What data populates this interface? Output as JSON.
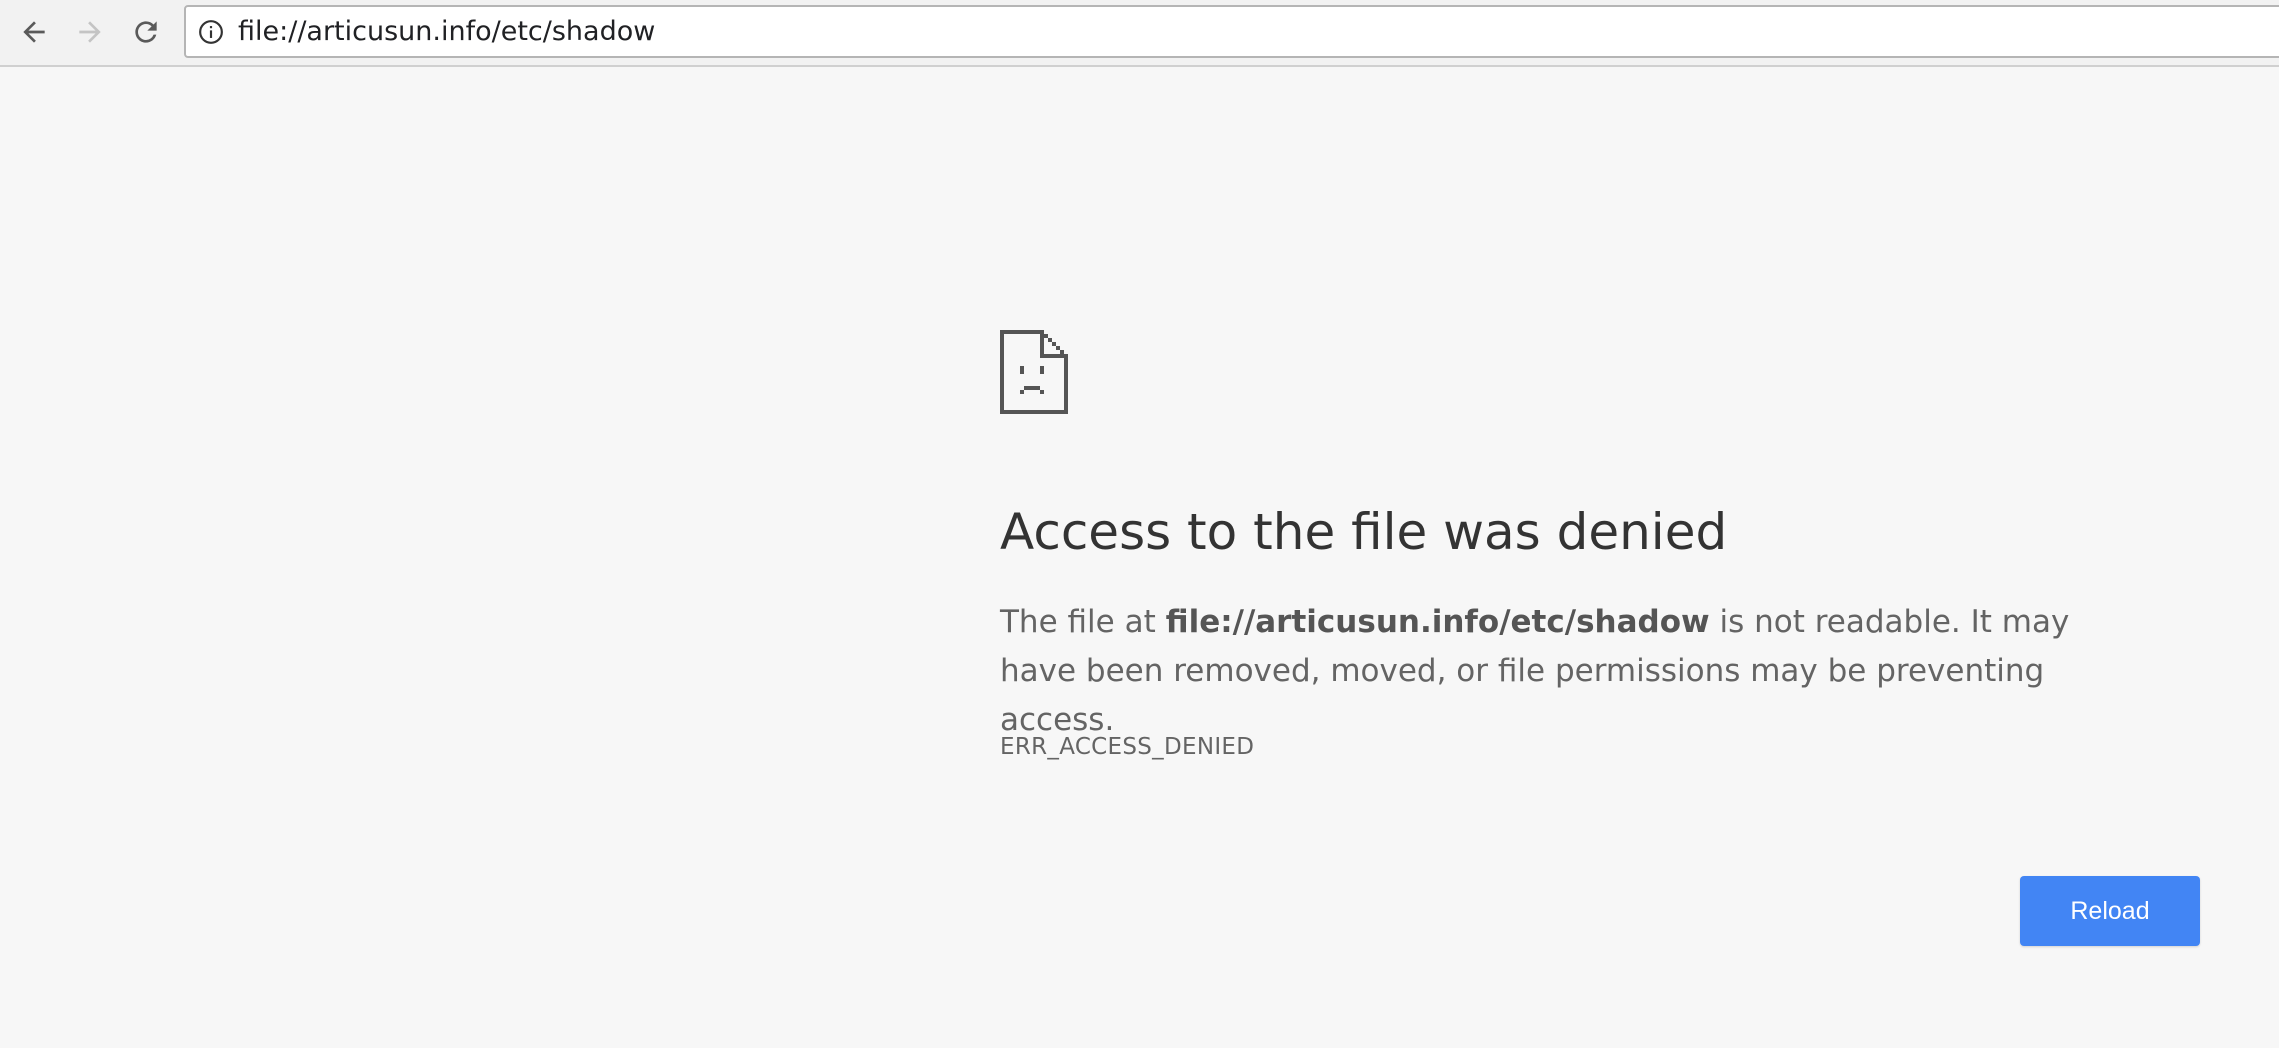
{
  "browser": {
    "address_bar": {
      "url": "file://articusun.info/etc/shadow",
      "security_icon": "info-icon"
    },
    "nav": {
      "back_icon": "arrow-left-icon",
      "forward_icon": "arrow-right-icon",
      "reload_icon": "reload-icon",
      "forward_enabled": false
    }
  },
  "error_page": {
    "icon": "sad-file-icon",
    "heading": "Access to the file was denied",
    "message_prefix": "The file at ",
    "message_url": "file://articusun.info/etc/shadow",
    "message_suffix": " is not readable. It may have been removed, moved, or file permissions may be preventing access.",
    "error_code": "ERR_ACCESS_DENIED",
    "reload_label": "Reload"
  },
  "colors": {
    "page_background": "#f7f7f7",
    "accent_button": "#4285f4",
    "heading_text": "#333333",
    "body_text": "#646464"
  }
}
